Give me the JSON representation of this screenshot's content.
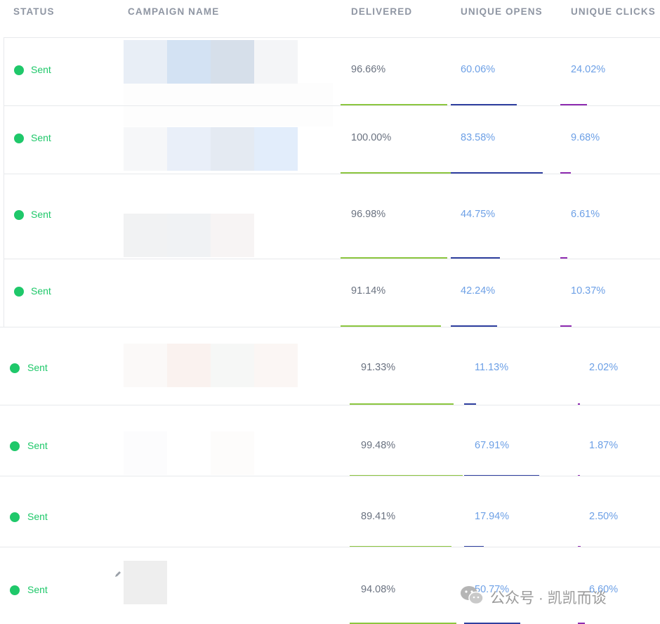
{
  "columns": {
    "status": "STATUS",
    "campaign": "CAMPAIGN NAME",
    "delivered": "DELIVERED",
    "opens": "UNIQUE OPENS",
    "clicks": "UNIQUE CLICKS"
  },
  "rows": [
    {
      "status": "Sent",
      "delivered": "96.66%",
      "opens": "60.06%",
      "clicks": "24.02%",
      "delivered_frac": 0.9666,
      "opens_frac": 0.6006,
      "clicks_frac": 0.2402
    },
    {
      "status": "Sent",
      "delivered": "100.00%",
      "opens": "83.58%",
      "clicks": "9.68%",
      "delivered_frac": 1.0,
      "opens_frac": 0.8358,
      "clicks_frac": 0.0968
    },
    {
      "status": "Sent",
      "delivered": "96.98%",
      "opens": "44.75%",
      "clicks": "6.61%",
      "delivered_frac": 0.9698,
      "opens_frac": 0.4475,
      "clicks_frac": 0.0661
    },
    {
      "status": "Sent",
      "delivered": "91.14%",
      "opens": "42.24%",
      "clicks": "10.37%",
      "delivered_frac": 0.9114,
      "opens_frac": 0.4224,
      "clicks_frac": 0.1037
    },
    {
      "status": "Sent",
      "delivered": "91.33%",
      "opens": "11.13%",
      "clicks": "2.02%",
      "delivered_frac": 0.9133,
      "opens_frac": 0.1113,
      "clicks_frac": 0.0202
    },
    {
      "status": "Sent",
      "delivered": "99.48%",
      "opens": "67.91%",
      "clicks": "1.87%",
      "delivered_frac": 0.9948,
      "opens_frac": 0.6791,
      "clicks_frac": 0.0187
    },
    {
      "status": "Sent",
      "delivered": "89.41%",
      "opens": "17.94%",
      "clicks": "2.50%",
      "delivered_frac": 0.8941,
      "opens_frac": 0.1794,
      "clicks_frac": 0.025
    },
    {
      "status": "Sent",
      "delivered": "94.08%",
      "opens": "50.77%",
      "clicks": "6.60%",
      "delivered_frac": 0.9408,
      "opens_frac": 0.5077,
      "clicks_frac": 0.066
    }
  ],
  "colors": {
    "status_green": "#1fc86a",
    "delivered_bar": "#8cc63f",
    "opens_bar": "#2f3f9f",
    "clicks_bar": "#8e2bb0",
    "value_blue": "#6da0e6",
    "value_gray": "#6a7280"
  },
  "watermark": {
    "icon": "wechat-icon",
    "text": "公众号 · 凯凯而谈"
  }
}
